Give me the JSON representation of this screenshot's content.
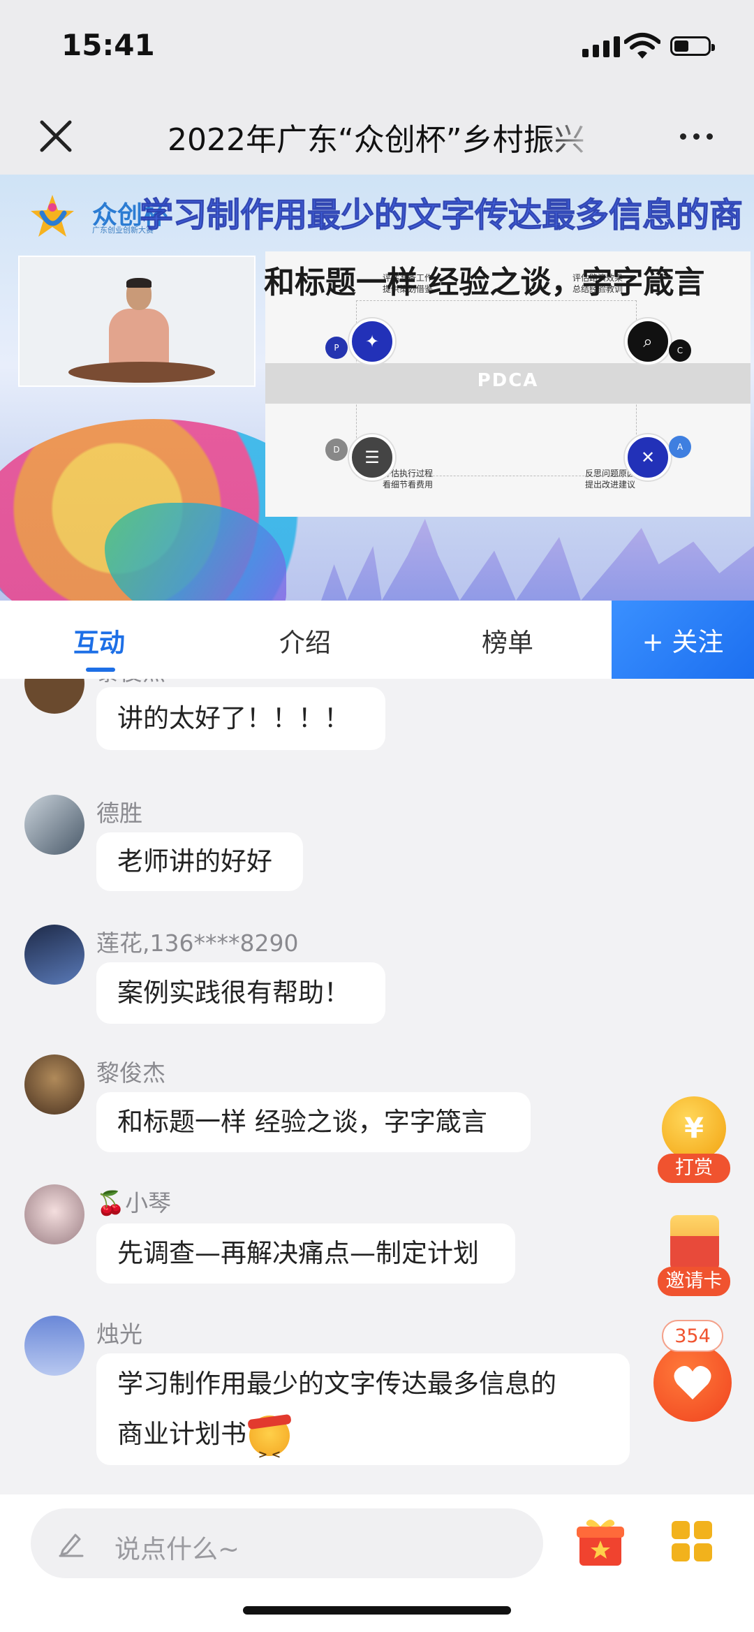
{
  "status": {
    "time": "15:41"
  },
  "header": {
    "title": "2022年广东“众创杯”乡村振兴"
  },
  "video": {
    "brand": "众创杯",
    "brand_sub": "广东创业创新大赛",
    "banner_lines": [
      "学习制作用最少的文字传达最多信息的商",
      "和标题一样 经验之谈，字字箴言"
    ],
    "slide": {
      "band_label": "PDCA",
      "tags": [
        "P",
        "C",
        "D",
        "A"
      ],
      "top_left": "评估准备工作\n提供策划借鉴",
      "top_right": "评估路演效果\n总结经验教训",
      "bottom_left": "评估执行过程\n看细节看费用",
      "bottom_right": "反思问题原因\n提出改进建议"
    }
  },
  "tabs": [
    {
      "label": "互动",
      "active": true
    },
    {
      "label": "介绍",
      "active": false
    },
    {
      "label": "榜单",
      "active": false
    }
  ],
  "follow_label": "+ 关注",
  "messages": [
    {
      "user": "黎俊杰",
      "text": "讲的太好了！！！！",
      "avatar_color": "#6a4a2e"
    },
    {
      "user": "德胜",
      "text": "老师讲的好好",
      "avatar_color": "#5a6b7a"
    },
    {
      "user": "莲花,136****8290",
      "text": "案例实践很有帮助！",
      "avatar_color": "#2c3a5a"
    },
    {
      "user": "黎俊杰",
      "text": "和标题一样 经验之谈，字字箴言",
      "avatar_color": "#6a4a2e"
    },
    {
      "user": "小琴",
      "user_prefix": "🍒",
      "text": "先调查—再解决痛点—制定计划",
      "avatar_color": "#d8c8c8"
    },
    {
      "user": "烛光",
      "text_line1": "学习制作用最少的文字传达最多信息的",
      "text_line2": "商业计划书",
      "avatar_color": "#8aa6e6"
    }
  ],
  "actions": {
    "reward_label": "打赏",
    "invite_label": "邀请卡",
    "like_count": "354"
  },
  "bottom": {
    "placeholder": "说点什么~"
  },
  "colors": {
    "accent": "#1d6fe6",
    "orange": "#f0532f"
  }
}
